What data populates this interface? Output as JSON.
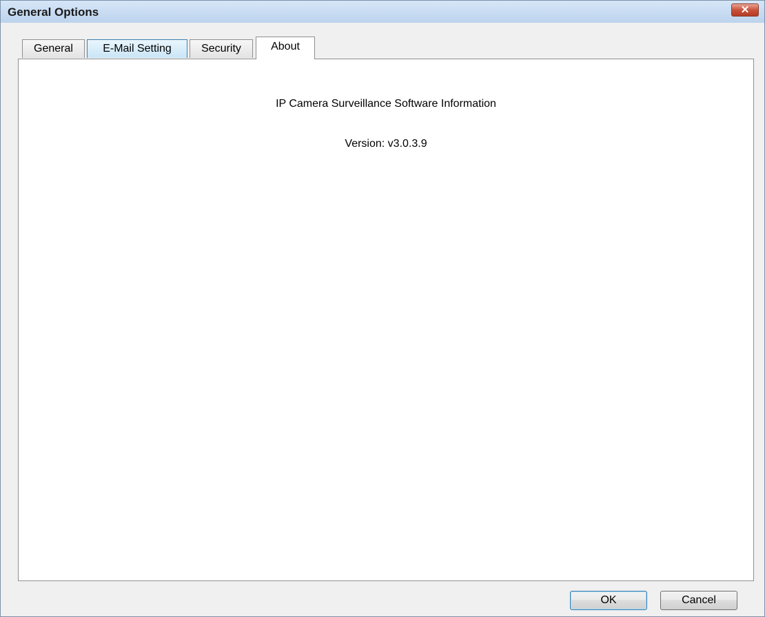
{
  "window": {
    "title": "General Options"
  },
  "tabs": [
    {
      "label": "General"
    },
    {
      "label": "E-Mail Setting"
    },
    {
      "label": "Security"
    },
    {
      "label": "About"
    }
  ],
  "active_tab": "About",
  "about": {
    "info_title": "IP Camera Surveillance Software Information",
    "version": "Version: v3.0.3.9"
  },
  "buttons": {
    "ok": "OK",
    "cancel": "Cancel"
  },
  "icons": {
    "close": "close-icon"
  },
  "colors": {
    "title_bar": "#bcd3ed",
    "close_button": "#c8523b",
    "accent": "#3c7fb1"
  }
}
